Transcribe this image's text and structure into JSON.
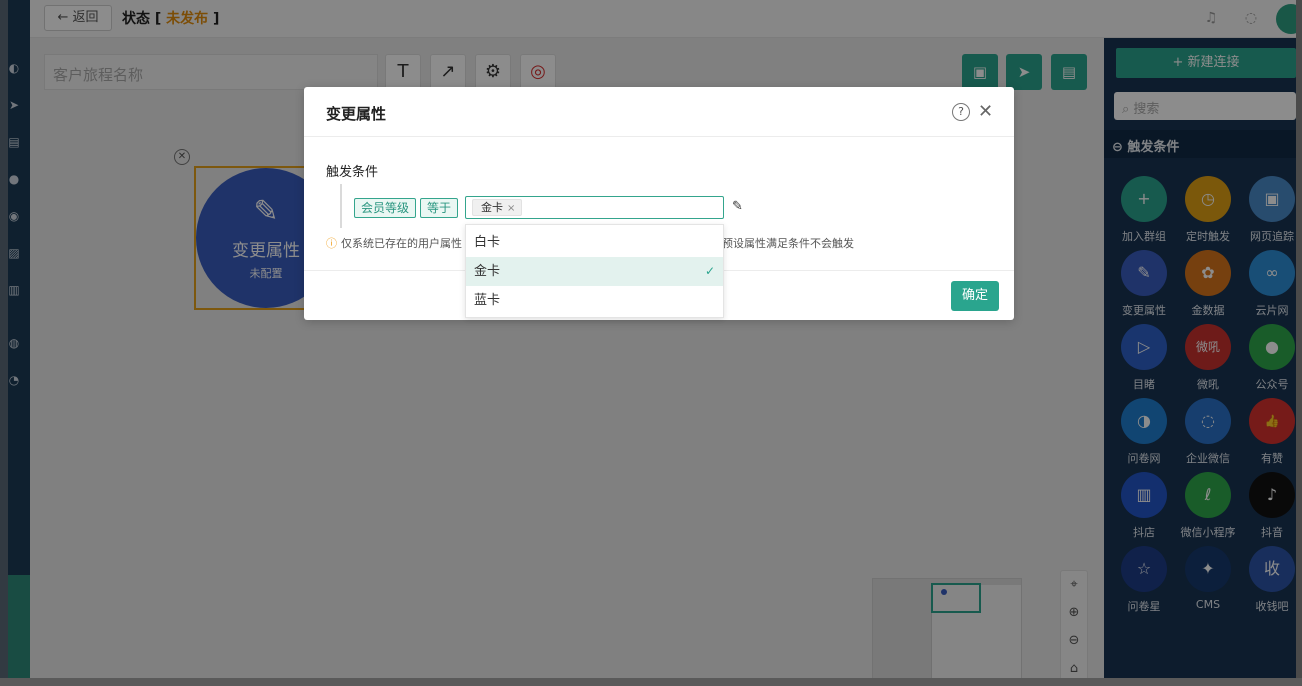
{
  "topbar": {
    "back_label": "← 返回",
    "status_prefix": "状态 [ ",
    "status_value": "未发布",
    "status_suffix": " ]"
  },
  "canvas": {
    "journey_name_placeholder": "客户旅程名称",
    "tools": [
      "T",
      "↗"
    ],
    "node": {
      "title": "变更属性",
      "subtitle": "未配置"
    }
  },
  "right_panel": {
    "new_connection_label": "+ 新建连接",
    "search_placeholder": "搜索",
    "section_title": "触发条件",
    "items": [
      {
        "label": "加入群组",
        "color": "#2aa58e",
        "glyph": "+"
      },
      {
        "label": "定时触发",
        "color": "#e0a015",
        "glyph": "◷"
      },
      {
        "label": "网页追踪",
        "color": "#4a8ac8",
        "glyph": "▣"
      },
      {
        "label": "变更属性",
        "color": "#3a5dc0",
        "glyph": "✎"
      },
      {
        "label": "金数据",
        "color": "#d8761c",
        "glyph": "✿"
      },
      {
        "label": "云片网",
        "color": "#2d8fd8",
        "glyph": "∞"
      },
      {
        "label": "目睹",
        "color": "#2f62c8",
        "glyph": "▷"
      },
      {
        "label": "微吼",
        "color": "#c8322f",
        "glyph": "微吼"
      },
      {
        "label": "公众号",
        "color": "#2fa84b",
        "glyph": "●"
      },
      {
        "label": "问卷网",
        "color": "#1f7fd0",
        "glyph": "◑"
      },
      {
        "label": "企业微信",
        "color": "#2a72c8",
        "glyph": "◌"
      },
      {
        "label": "有赞",
        "color": "#d8322f",
        "glyph": "👍"
      },
      {
        "label": "抖店",
        "color": "#2456c8",
        "glyph": "▥"
      },
      {
        "label": "微信小程序",
        "color": "#2fa84b",
        "glyph": "ℓ"
      },
      {
        "label": "抖音",
        "color": "#111111",
        "glyph": "♪"
      },
      {
        "label": "问卷星",
        "color": "#1e3d88",
        "glyph": "☆"
      },
      {
        "label": "CMS",
        "color": "#163a6e",
        "glyph": "✦"
      },
      {
        "label": "收钱吧",
        "color": "#2d55a8",
        "glyph": "收"
      }
    ]
  },
  "modal": {
    "title": "变更属性",
    "section_label": "触发条件",
    "attribute_tag": "会员等级",
    "operator_tag": "等于",
    "selected_chip": "金卡",
    "note_left": "仅系统已存在的用户属性",
    "note_right": "预设属性满足条件不会触发",
    "confirm_label": "确定"
  },
  "dropdown": {
    "options": [
      {
        "label": "白卡",
        "selected": false
      },
      {
        "label": "金卡",
        "selected": true
      },
      {
        "label": "蓝卡",
        "selected": false
      }
    ],
    "check_glyph": "✓"
  }
}
